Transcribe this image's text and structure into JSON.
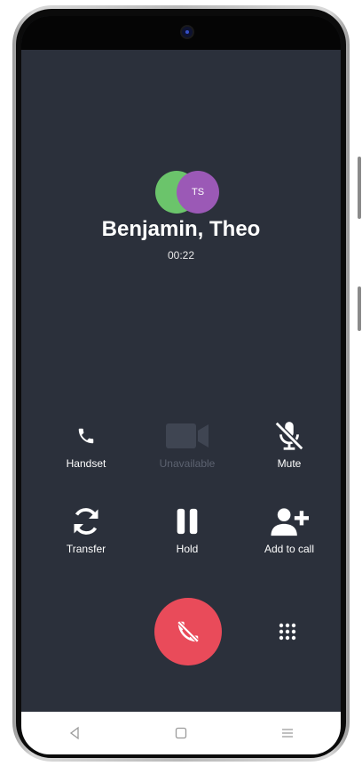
{
  "call": {
    "name": "Benjamin, Theo",
    "duration": "00:22",
    "avatars": [
      {
        "initials": "",
        "color": "#6bc46b"
      },
      {
        "initials": "TS",
        "color": "#9b59b6"
      }
    ]
  },
  "actions": {
    "handset": {
      "label": "Handset",
      "icon": "phone-icon"
    },
    "video": {
      "label": "Unavailable",
      "icon": "video-camera-icon",
      "enabled": false
    },
    "mute": {
      "label": "Mute",
      "icon": "microphone-off-icon"
    },
    "transfer": {
      "label": "Transfer",
      "icon": "transfer-arrows-icon"
    },
    "hold": {
      "label": "Hold",
      "icon": "pause-icon"
    },
    "add_to_call": {
      "label": "Add to call",
      "icon": "add-person-icon"
    }
  },
  "end_call": {
    "icon": "phone-hangup-icon",
    "color": "#e94b5a"
  },
  "keypad": {
    "icon": "dialpad-icon"
  },
  "nav": {
    "back": "back-icon",
    "home": "home-icon",
    "recents": "recents-menu-icon"
  },
  "colors": {
    "background": "#2b303b",
    "text": "#ffffff",
    "disabled": "#5c6270"
  }
}
